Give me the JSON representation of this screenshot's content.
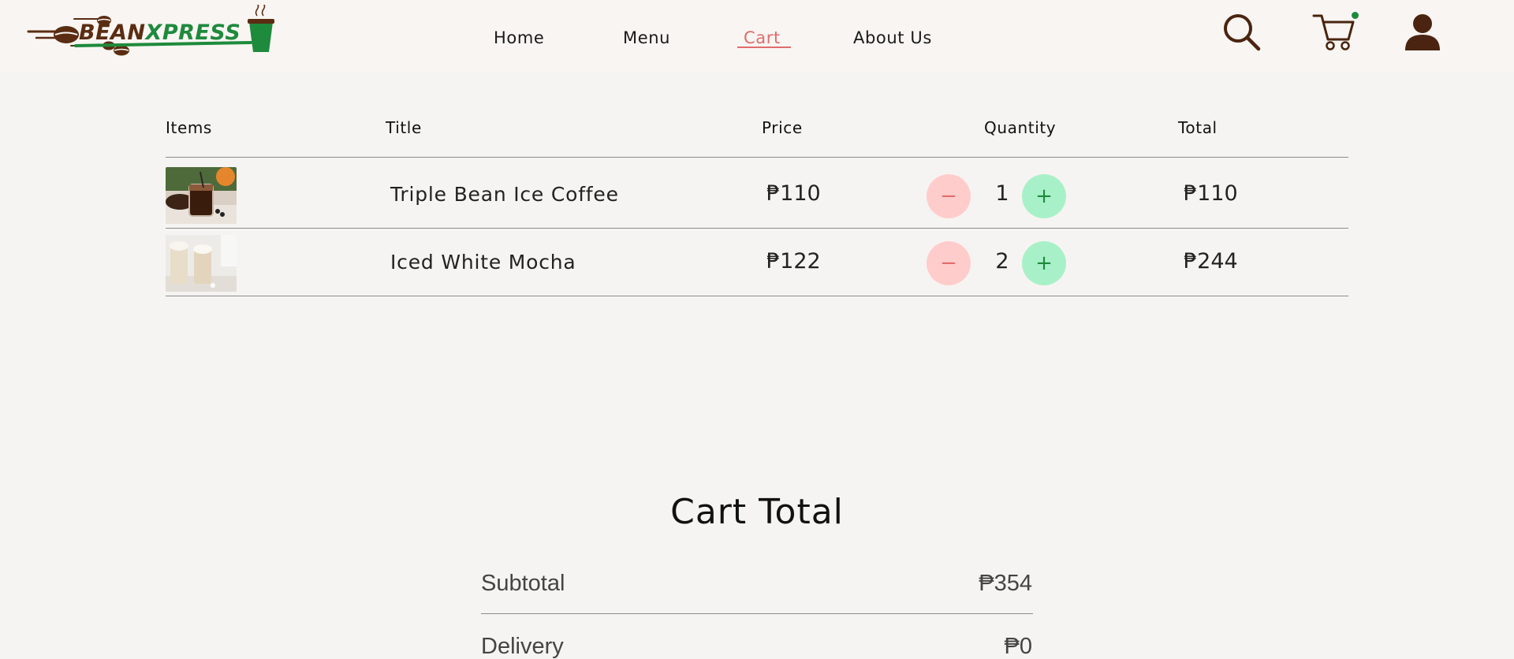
{
  "brand": {
    "logo_prefix": "BEAN",
    "logo_suffix": "XPRESS",
    "colors": {
      "brown": "#5a2d12",
      "green": "#1e8a3c",
      "accent": "#e06d6d"
    }
  },
  "nav": {
    "home": "Home",
    "menu": "Menu",
    "cart": "Cart",
    "about": "About Us",
    "active": "Cart"
  },
  "header_icons": [
    "search-icon",
    "cart-icon",
    "user-icon"
  ],
  "cart_table": {
    "headers": {
      "items": "Items",
      "title": "Title",
      "price": "Price",
      "quantity": "Quantity",
      "total": "Total"
    },
    "rows": [
      {
        "title": "Triple Bean Ice Coffee",
        "price": "₱110",
        "quantity": "1",
        "total": "₱110"
      },
      {
        "title": "Iced White Mocha",
        "price": "₱122",
        "quantity": "2",
        "total": "₱244"
      }
    ],
    "minus_symbol": "−",
    "plus_symbol": "+"
  },
  "cart_total": {
    "heading": "Cart Total",
    "subtotal_label": "Subtotal",
    "subtotal_value": "₱354",
    "delivery_label": "Delivery",
    "delivery_value": "₱0"
  }
}
